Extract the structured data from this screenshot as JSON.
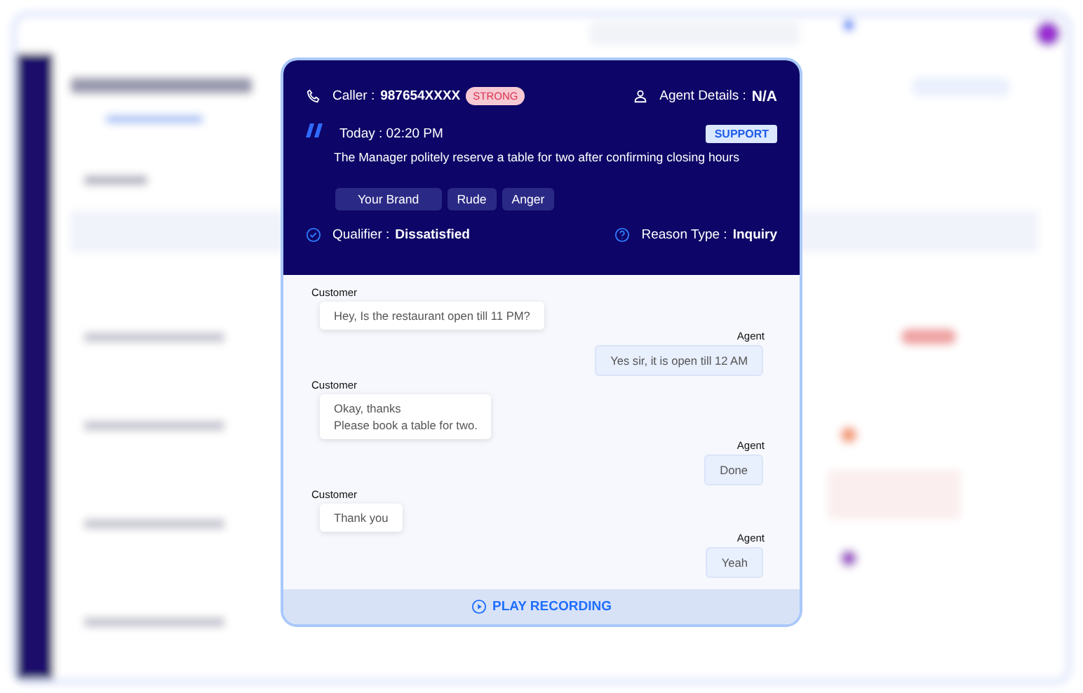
{
  "call": {
    "caller_label": "Caller :",
    "caller_number": "987654XXXX",
    "strength_badge": "STRONG",
    "agent_label": "Agent Details :",
    "agent_value": "N/A",
    "time": "Today : 02:20 PM",
    "category_badge": "SUPPORT",
    "summary": "The Manager politely reserve a table for two after confirming closing hours",
    "tags": [
      "Your Brand",
      "Rude",
      "Anger"
    ],
    "qualifier_label": "Qualifier :",
    "qualifier_value": "Dissatisfied",
    "reason_label": "Reason Type :",
    "reason_value": "Inquiry"
  },
  "messages": [
    {
      "kind": "customer",
      "sender": "Customer",
      "lines": [
        "Hey, Is the restaurant open till 11 PM?"
      ]
    },
    {
      "kind": "agent",
      "sender": "Agent",
      "lines": [
        "Yes sir, it is open till 12 AM"
      ]
    },
    {
      "kind": "customer",
      "sender": "Customer",
      "lines": [
        "Okay, thanks",
        "Please book a table for two."
      ]
    },
    {
      "kind": "agent",
      "sender": "Agent",
      "lines": [
        "Done"
      ]
    },
    {
      "kind": "customer",
      "sender": "Customer",
      "lines": [
        "Thank you"
      ]
    },
    {
      "kind": "agent",
      "sender": "Agent",
      "lines": [
        "Yeah"
      ]
    }
  ],
  "footer": {
    "button": "PLAY RECORDING"
  }
}
